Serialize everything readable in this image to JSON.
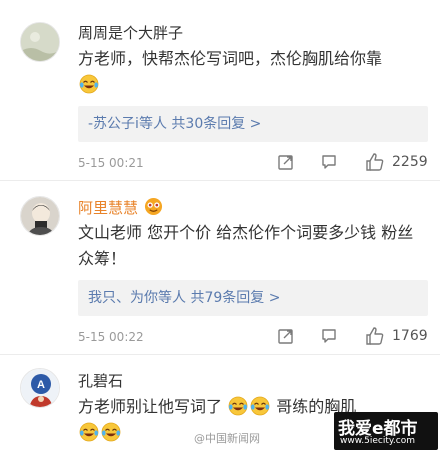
{
  "comments": [
    {
      "username": "周周是个大胖子",
      "text": "方老师，快帮杰伦写词吧，杰伦胸肌给你靠",
      "reply_users": "-苏公子i等人",
      "reply_count": "共30条回复 >",
      "time": "5-15 00:21",
      "likes": "2259"
    },
    {
      "username": "阿里慧慧",
      "text": "文山老师 您开个价 给杰伦作个词要多少钱 粉丝众筹！",
      "reply_users": "我只、为你等人",
      "reply_count": "共79条回复 >",
      "time": "5-15 00:22",
      "likes": "1769"
    },
    {
      "username": "孔碧石",
      "text_a": "方老师别让他写词了",
      "text_b": "哥练的胸肌"
    }
  ],
  "icons": {
    "repost": "repost-icon",
    "comment": "comment-icon",
    "like": "thumbs-up-icon",
    "emoji": "laughing-tears-emoji"
  },
  "colors": {
    "reply_blue": "#5b7bae",
    "vip_name": "#e8832a",
    "reply_bg": "#f2f2f2"
  },
  "watermark": "@中国新闻网",
  "logo": {
    "main": "我爱e都市",
    "sub": "www.5iecity.com"
  }
}
